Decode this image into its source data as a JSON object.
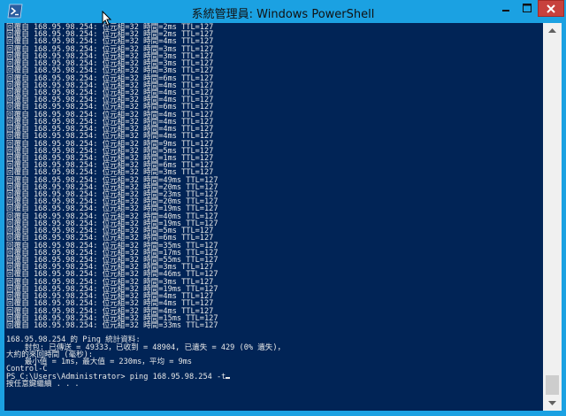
{
  "window": {
    "title": "系統管理員: Windows PowerShell",
    "buttons": {
      "minimize": "minimize",
      "maximize": "maximize",
      "close": "close"
    },
    "colors": {
      "frame": "#1ba1e2",
      "console_bg": "#012456",
      "console_fg": "#e8e8e8",
      "close": "#c7413d"
    }
  },
  "console": {
    "lines": [
      "回覆自 168.95.98.254: 位元組=32 時間=2ms TTL=127",
      "回覆自 168.95.98.254: 位元組=32 時間=2ms TTL=127",
      "回覆自 168.95.98.254: 位元組=32 時間=4ms TTL=127",
      "回覆自 168.95.98.254: 位元組=32 時間=3ms TTL=127",
      "回覆自 168.95.98.254: 位元組=32 時間=3ms TTL=127",
      "回覆自 168.95.98.254: 位元組=32 時間=3ms TTL=127",
      "回覆自 168.95.98.254: 位元組=32 時間=3ms TTL=127",
      "回覆自 168.95.98.254: 位元組=32 時間=6ms TTL=127",
      "回覆自 168.95.98.254: 位元組=32 時間=4ms TTL=127",
      "回覆自 168.95.98.254: 位元組=32 時間=4ms TTL=127",
      "回覆自 168.95.98.254: 位元組=32 時間=4ms TTL=127",
      "回覆自 168.95.98.254: 位元組=32 時間=6ms TTL=127",
      "回覆自 168.95.98.254: 位元組=32 時間=4ms TTL=127",
      "回覆自 168.95.98.254: 位元組=32 時間=4ms TTL=127",
      "回覆自 168.95.98.254: 位元組=32 時間=4ms TTL=127",
      "回覆自 168.95.98.254: 位元組=32 時間=4ms TTL=127",
      "回覆自 168.95.98.254: 位元組=32 時間=9ms TTL=127",
      "回覆自 168.95.98.254: 位元組=32 時間=5ms TTL=127",
      "回覆自 168.95.98.254: 位元組=32 時間=1ms TTL=127",
      "回覆自 168.95.98.254: 位元組=32 時間=6ms TTL=127",
      "回覆自 168.95.98.254: 位元組=32 時間=3ms TTL=127",
      "回覆自 168.95.98.254: 位元組=32 時間=49ms TTL=127",
      "回覆自 168.95.98.254: 位元組=32 時間=20ms TTL=127",
      "回覆自 168.95.98.254: 位元組=32 時間=23ms TTL=127",
      "回覆自 168.95.98.254: 位元組=32 時間=20ms TTL=127",
      "回覆自 168.95.98.254: 位元組=32 時間=19ms TTL=127",
      "回覆自 168.95.98.254: 位元組=32 時間=40ms TTL=127",
      "回覆自 168.95.98.254: 位元組=32 時間=19ms TTL=127",
      "回覆自 168.95.98.254: 位元組=32 時間=5ms TTL=127",
      "回覆自 168.95.98.254: 位元組=32 時間=6ms TTL=127",
      "回覆自 168.95.98.254: 位元組=32 時間=35ms TTL=127",
      "回覆自 168.95.98.254: 位元組=32 時間=17ms TTL=127",
      "回覆自 168.95.98.254: 位元組=32 時間=55ms TTL=127",
      "回覆自 168.95.98.254: 位元組=32 時間=3ms TTL=127",
      "回覆自 168.95.98.254: 位元組=32 時間=46ms TTL=127",
      "回覆自 168.95.98.254: 位元組=32 時間=3ms TTL=127",
      "回覆自 168.95.98.254: 位元組=32 時間=19ms TTL=127",
      "回覆自 168.95.98.254: 位元組=32 時間=4ms TTL=127",
      "回覆自 168.95.98.254: 位元組=32 時間=4ms TTL=127",
      "回覆自 168.95.98.254: 位元組=32 時間=4ms TTL=127",
      "回覆自 168.95.98.254: 位元組=32 時間=15ms TTL=127",
      "回覆自 168.95.98.254: 位元組=32 時間=33ms TTL=127",
      "",
      "168.95.98.254 的 Ping 統計資料:",
      "    封包: 已傳送 = 49333，已收到 = 48904, 已遺失 = 429 (0% 遺失)，",
      "大約的來回時間 (毫秒):",
      "    最小值 = 1ms，最大值 = 230ms，平均 = 9ms",
      "Control-C",
      "PS C:\\Users\\Administrator> ping 168.95.98.254 -t",
      "按任意鍵繼續 . . ."
    ]
  }
}
